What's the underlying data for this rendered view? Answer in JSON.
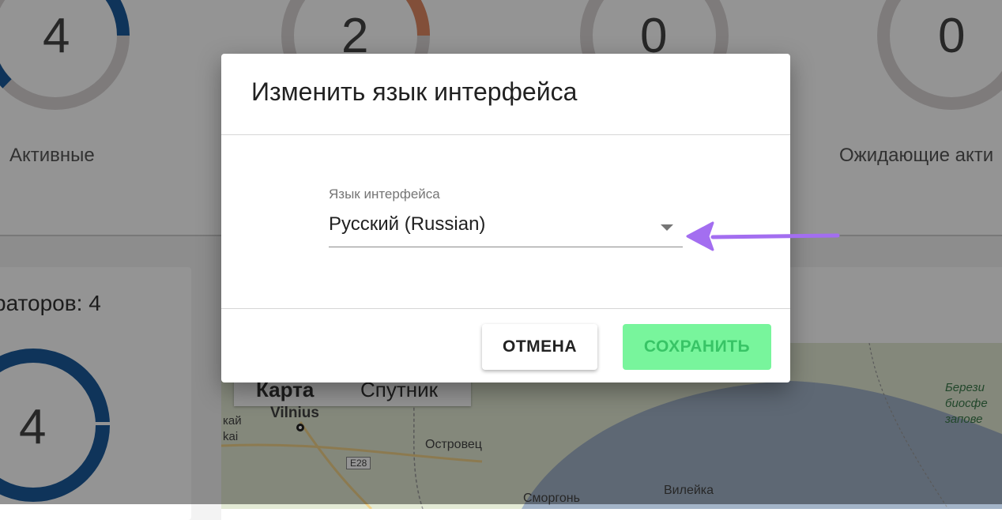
{
  "dashboard": {
    "stats": [
      {
        "value": "4",
        "label": "Активные"
      },
      {
        "value": "2",
        "label": ""
      },
      {
        "value": "0",
        "label": ""
      },
      {
        "value": "0",
        "label": "Ожидающие акти"
      }
    ],
    "operators_title": "раторов: 4",
    "operators_value": "4",
    "map": {
      "tab_map": "Карта",
      "tab_satellite": "Спутник",
      "labels": [
        "Vilnius",
        "кай",
        "kai",
        "Островец",
        "E28",
        "Сморгонь",
        "Вилейка",
        "Берези",
        "биосфе",
        "запове"
      ]
    },
    "colors": {
      "ring_blue": "#1a5a9c",
      "ring_orange": "#e08862",
      "ring_grey": "#d9d5d5"
    }
  },
  "dialog": {
    "title": "Изменить язык интерфейса",
    "field_label": "Язык интерфейса",
    "selected_language": "Русский (Russian)",
    "cancel_label": "ОТМЕНА",
    "save_label": "СОХРАНИТЬ"
  },
  "annotation": {
    "arrow_color": "#a36ef0"
  }
}
